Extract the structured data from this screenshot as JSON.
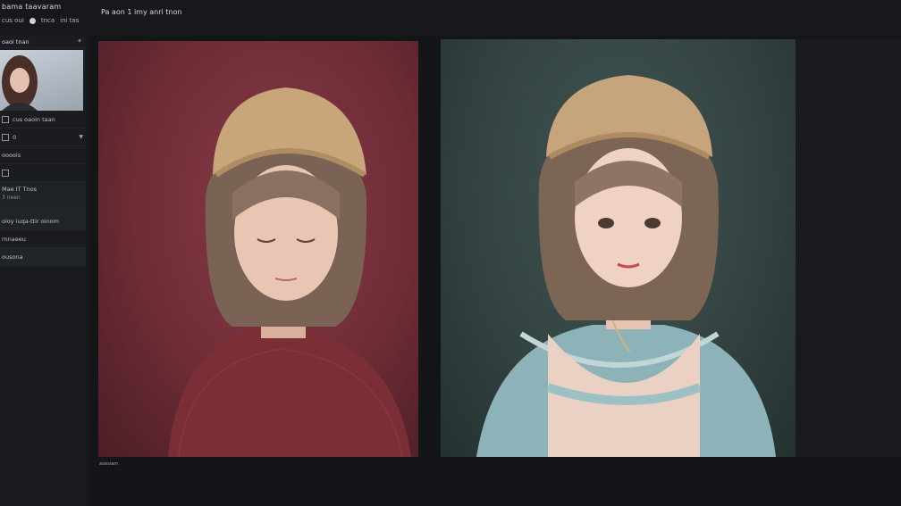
{
  "app": {
    "title": "bama taavaram",
    "meta": [
      "cus oui",
      "tnca",
      "ini tas"
    ],
    "center_title": "Pa aon 1 imy anri tnon"
  },
  "sidebar": {
    "header": "oaoi tnan",
    "pin_icon": "pin-icon",
    "rows": [
      {
        "label": "cus oaoin taan",
        "type": "text"
      },
      {
        "label": "0",
        "type": "select"
      },
      {
        "label": "oooois",
        "type": "text"
      },
      {
        "label": "",
        "type": "checkbox"
      },
      {
        "label": "Mae IT Tnos",
        "sub": "3 neen",
        "type": "tall"
      },
      {
        "label": "oioy iuqa-ttir oinom",
        "type": "band"
      },
      {
        "label": "rnnaeeu",
        "type": "text"
      },
      {
        "label": "ousona",
        "type": "band"
      }
    ]
  },
  "main": {
    "caption": "aoesiam",
    "panels": [
      {
        "name": "image-left"
      },
      {
        "name": "image-right"
      }
    ]
  }
}
